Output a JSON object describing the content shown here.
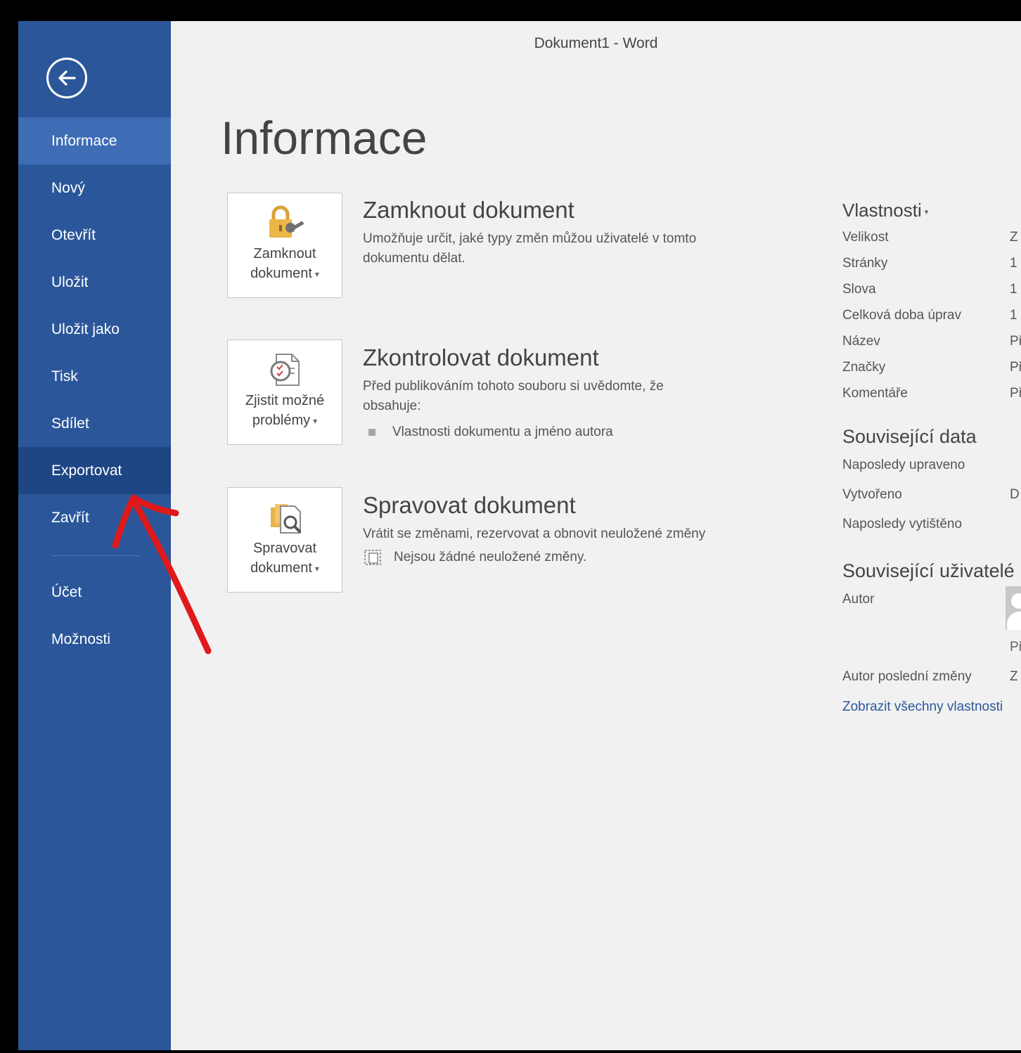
{
  "window": {
    "title": "Dokument1 - Word"
  },
  "sidebar": {
    "items": [
      {
        "label": "Informace",
        "state": "active"
      },
      {
        "label": "Nový"
      },
      {
        "label": "Otevřít"
      },
      {
        "label": "Uložit"
      },
      {
        "label": "Uložit jako"
      },
      {
        "label": "Tisk"
      },
      {
        "label": "Sdílet"
      },
      {
        "label": "Exportovat",
        "state": "hover"
      },
      {
        "label": "Zavřít"
      }
    ],
    "bottom_items": [
      {
        "label": "Účet"
      },
      {
        "label": "Možnosti"
      }
    ],
    "color": "#2b579a"
  },
  "page": {
    "title": "Informace"
  },
  "sections": [
    {
      "tile_line1": "Zamknout",
      "tile_line2": "dokument",
      "icon": "lock-key-icon",
      "title": "Zamknout dokument",
      "description": "Umožňuje určit, jaké typy změn můžou uživatelé v tomto dokumentu dělat."
    },
    {
      "tile_line1": "Zjistit možné",
      "tile_line2": "problémy",
      "icon": "inspect-document-icon",
      "title": "Zkontrolovat dokument",
      "description": "Před publikováním tohoto souboru si uvědomte, že obsahuje:",
      "bullet": "Vlastnosti dokumentu a jméno autora"
    },
    {
      "tile_line1": "Spravovat",
      "tile_line2": "dokument",
      "icon": "manage-document-icon",
      "title": "Spravovat dokument",
      "description": "Vrátit se změnami, rezervovat a obnovit neuložené změny",
      "bullet": "Nejsou žádné neuložené změny."
    }
  ],
  "properties": {
    "heading": "Vlastnosti",
    "rows": [
      {
        "label": "Velikost",
        "value": "Z"
      },
      {
        "label": "Stránky",
        "value": "1"
      },
      {
        "label": "Slova",
        "value": "1"
      },
      {
        "label": "Celková doba úprav",
        "value": "1"
      },
      {
        "label": "Název",
        "value": "Př"
      },
      {
        "label": "Značky",
        "value": "Př"
      },
      {
        "label": "Komentáře",
        "value": "Př"
      }
    ],
    "related_dates_heading": "Související data",
    "date_rows": [
      {
        "label": "Naposledy upraveno",
        "value": ""
      },
      {
        "label": "Vytvořeno",
        "value": "D"
      },
      {
        "label": "Naposledy vytištěno",
        "value": ""
      }
    ],
    "related_people_heading": "Související uživatelé",
    "author_label": "Autor",
    "author_sub": "Př",
    "last_modified_by_label": "Autor poslední změny",
    "last_modified_by_value": "Z",
    "show_all_link": "Zobrazit všechny vlastnosti"
  },
  "annotation": {
    "type": "red-arrow",
    "color": "#e0191b"
  }
}
